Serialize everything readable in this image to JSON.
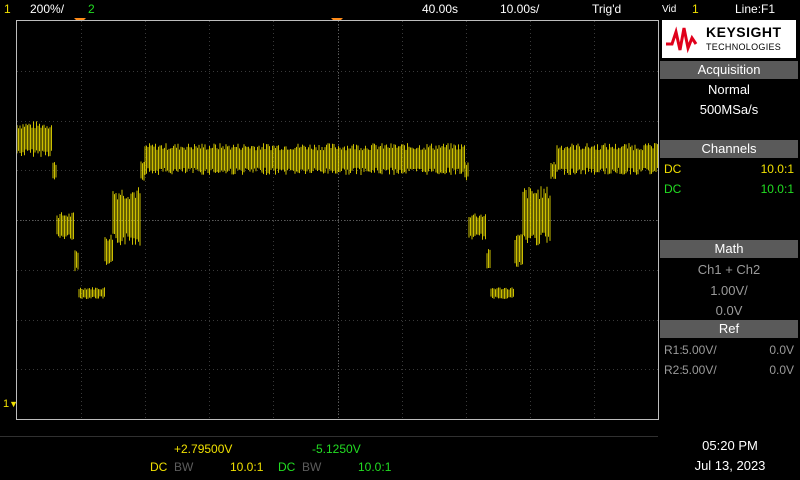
{
  "topbar": {
    "ch1_number": "1",
    "ch1_scale": "200%/",
    "ch2_number": "2",
    "time_delay": "40.00s",
    "time_scale": "10.00s/",
    "trigger_status": "Trig'd",
    "trigger_label": "Vid",
    "trigger_channel": "1",
    "line": "Line:F1"
  },
  "brand": {
    "name": "KEYSIGHT",
    "sub": "TECHNOLOGIES"
  },
  "acquisition": {
    "header": "Acquisition",
    "mode": "Normal",
    "rate": "500MSa/s"
  },
  "channels": {
    "header": "Channels",
    "rows": [
      {
        "coupling": "DC",
        "probe": "10.0:1"
      },
      {
        "coupling": "DC",
        "probe": "10.0:1"
      }
    ]
  },
  "math": {
    "header": "Math",
    "func": "Ch1 + Ch2",
    "scale": "1.00V/",
    "offset": "0.0V"
  },
  "ref": {
    "header": "Ref",
    "rows": [
      {
        "name": "R1:",
        "scale": "5.00V/",
        "offset": "0.0V"
      },
      {
        "name": "R2:",
        "scale": "5.00V/",
        "offset": "0.0V"
      }
    ]
  },
  "bottom": {
    "ch1": {
      "offset": "+2.79500V",
      "coupling": "DC",
      "bw": "BW",
      "probe": "10.0:1"
    },
    "ch2": {
      "offset": "-5.1250V",
      "coupling": "DC",
      "bw": "BW",
      "probe": "10.0:1"
    }
  },
  "clock": {
    "time": "05:20 PM",
    "date": "Jul 13, 2023"
  },
  "ground_marker": "1",
  "colors": {
    "ch1": "#f0e000",
    "ch2": "#22dd22",
    "panel_header": "#5a5a5a",
    "grid": "#3a3a3a"
  }
}
